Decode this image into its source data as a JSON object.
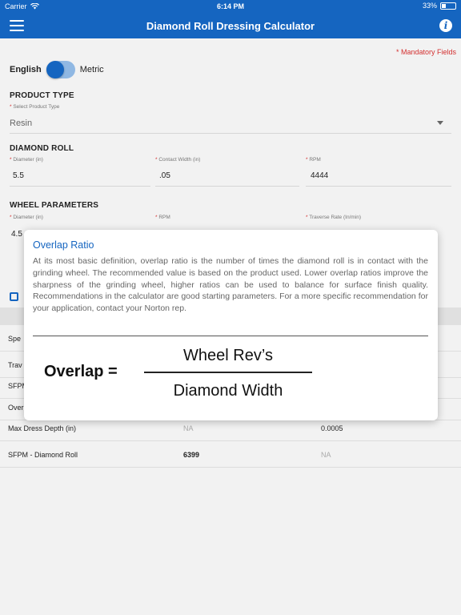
{
  "status": {
    "carrier": "Carrier",
    "time": "6:14 PM",
    "battery": "33%",
    "battery_level": 0.33
  },
  "header": {
    "title": "Diamond Roll Dressing Calculator"
  },
  "mandatory_note": "* Mandatory Fields",
  "units": {
    "english": "English",
    "metric": "Metric"
  },
  "product_type": {
    "title": "PRODUCT TYPE",
    "label": "Select Product Type",
    "value": "Resin"
  },
  "diamond_roll": {
    "title": "DIAMOND ROLL",
    "diameter_label": "Diameter (in)",
    "diameter_value": "5.5",
    "contact_width_label": "Contact Width (in)",
    "contact_width_value": ".05",
    "rpm_label": "RPM",
    "rpm_value": "4444"
  },
  "wheel_parameters": {
    "title": "WHEEL PARAMETERS",
    "diameter_label": "Diameter (in)",
    "diameter_value_partial": "4.5",
    "rpm_label": "RPM",
    "traverse_label": "Traverse Rate (In/min)"
  },
  "results": {
    "rows": [
      {
        "label": "Spe",
        "c1": "",
        "c2": ""
      },
      {
        "label": "Trav",
        "c1": "",
        "c2": ""
      },
      {
        "label": "SFPM",
        "c1": "",
        "c2": ""
      },
      {
        "label": "Over",
        "c1": "",
        "c2": ""
      },
      {
        "label": "Max Dress Depth (in)",
        "c1": "NA",
        "c2": "0.0005"
      },
      {
        "label": "SFPM - Diamond Roll",
        "c1": "6399",
        "c2": "NA"
      }
    ]
  },
  "popup": {
    "title": "Overlap Ratio",
    "body": "At its most basic definition, overlap ratio is the number of times the diamond roll is in contact with the grinding wheel. The recommended value is based on the product used. Lower overlap ratios improve the sharpness of the grinding wheel, higher ratios can be used to balance for surface finish quality. Recommendations in the calculator are good starting parameters. For a more specific recommendation for your application, contact your Norton rep.",
    "formula_lhs": "Overlap =",
    "formula_numerator": "Wheel Rev’s",
    "formula_denominator": "Diamond Width"
  },
  "colors": {
    "primary": "#1565c0",
    "required": "#d32f2f"
  },
  "icons": {
    "menu": "hamburger-menu-icon",
    "info": "info-icon",
    "wifi": "wifi-icon",
    "battery": "battery-icon"
  }
}
